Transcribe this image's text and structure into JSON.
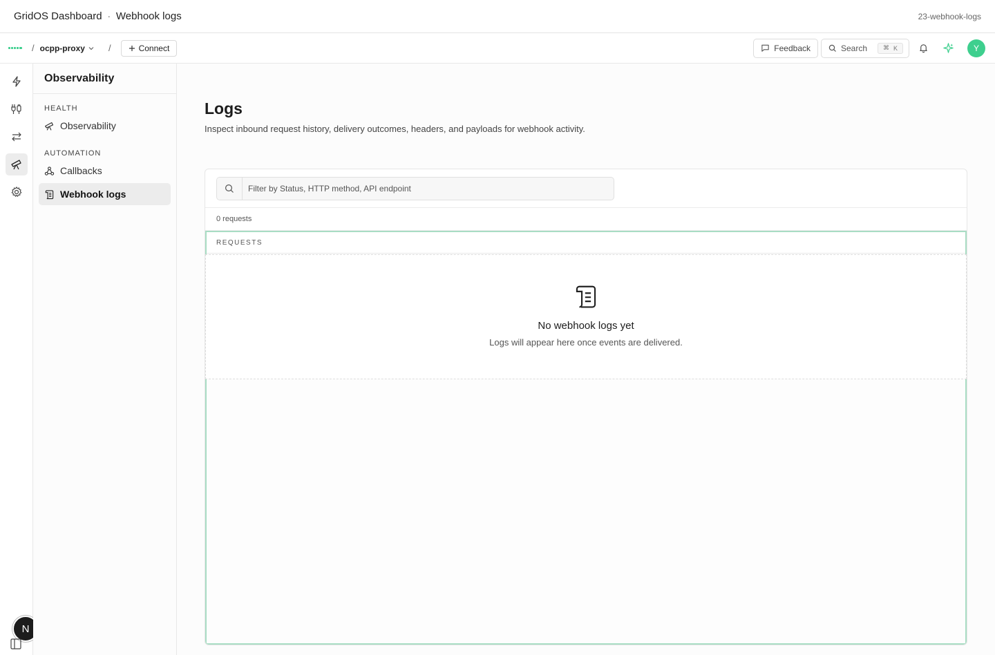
{
  "window": {
    "app_name": "GridOS Dashboard",
    "separator": "·",
    "page_name": "Webhook logs",
    "branch_label": "23-webhook-logs"
  },
  "topnav": {
    "slash": "/",
    "project": "ocpp-proxy",
    "connect_label": "Connect",
    "feedback_label": "Feedback",
    "search_label": "Search",
    "search_kbd_cmd": "⌘",
    "search_kbd_key": "K",
    "avatar_initial": "Y"
  },
  "rail": {
    "badge": "N"
  },
  "sidebar": {
    "title": "Observability",
    "sections": [
      {
        "label": "HEALTH",
        "items": [
          {
            "label": "Observability"
          }
        ]
      },
      {
        "label": "AUTOMATION",
        "items": [
          {
            "label": "Callbacks"
          },
          {
            "label": "Webhook logs"
          }
        ]
      }
    ]
  },
  "main": {
    "title": "Logs",
    "description": "Inspect inbound request history, delivery outcomes, headers, and payloads for webhook activity.",
    "filter_placeholder": "Filter by Status, HTTP method, API endpoint",
    "request_count": "0 requests",
    "table_header": "REQUESTS",
    "empty_title": "No webhook logs yet",
    "empty_subtitle": "Logs will appear here once events are delivered."
  },
  "colors": {
    "accent": "#3ecf8e",
    "table_border": "#a9ddc4"
  }
}
